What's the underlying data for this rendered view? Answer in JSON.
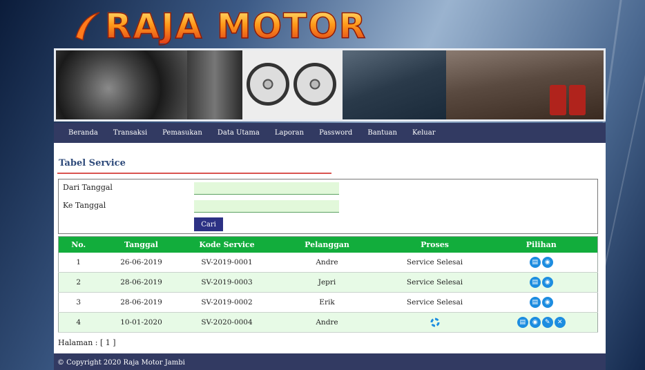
{
  "brand": {
    "logo_text": "RAJA MOTOR"
  },
  "nav": [
    "Beranda",
    "Transaksi",
    "Pemasukan",
    "Data Utama",
    "Laporan",
    "Password",
    "Bantuan",
    "Keluar"
  ],
  "page_title": "Tabel Service",
  "filter": {
    "from_label": "Dari Tanggal",
    "to_label": "Ke Tanggal",
    "from_value": "",
    "to_value": "",
    "button": "Cari"
  },
  "table": {
    "headers": [
      "No.",
      "Tanggal",
      "Kode Service",
      "Pelanggan",
      "Proses",
      "Pilihan"
    ],
    "rows": [
      {
        "no": "1",
        "tanggal": "26-06-2019",
        "kode": "SV-2019-0001",
        "pelanggan": "Andre",
        "proses": "Service Selesai",
        "actions": [
          "print-icon",
          "view-icon"
        ]
      },
      {
        "no": "2",
        "tanggal": "28-06-2019",
        "kode": "SV-2019-0003",
        "pelanggan": "Jepri",
        "proses": "Service Selesai",
        "actions": [
          "print-icon",
          "view-icon"
        ]
      },
      {
        "no": "3",
        "tanggal": "28-06-2019",
        "kode": "SV-2019-0002",
        "pelanggan": "Erik",
        "proses": "Service Selesai",
        "actions": [
          "print-icon",
          "view-icon"
        ]
      },
      {
        "no": "4",
        "tanggal": "10-01-2020",
        "kode": "SV-2020-0004",
        "pelanggan": "Andre",
        "proses": "",
        "process_icon": "loading-icon",
        "actions": [
          "print-icon",
          "view-icon",
          "edit-icon",
          "delete-icon"
        ]
      }
    ]
  },
  "pagination": "Halaman : [ 1 ]",
  "footer": "© Copyright 2020 Raja Motor Jambi",
  "colors": {
    "nav": "#323a62",
    "table_header": "#12ad3c",
    "row_alt": "#e7fae6",
    "action_icon": "#1d8de0"
  }
}
